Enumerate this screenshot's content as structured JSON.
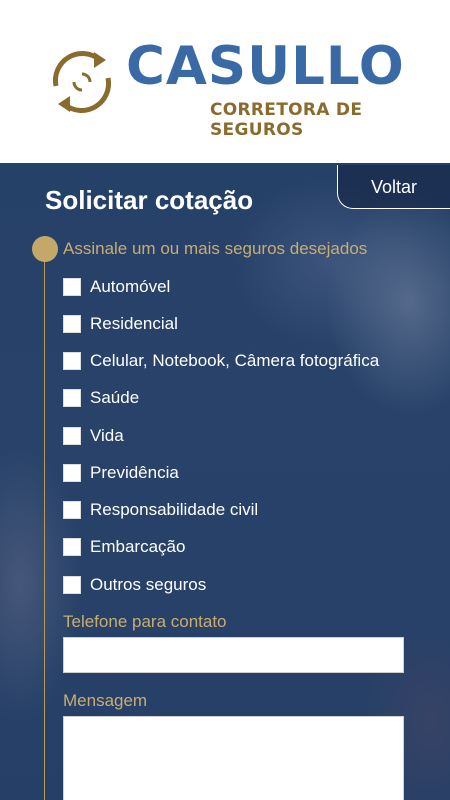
{
  "brand": {
    "name": "CASULLO",
    "subtitle": "CORRETORA DE SEGUROS",
    "logo_icon": "circular-arrows-icon",
    "colors": {
      "blue": "#3a6aa5",
      "gold": "#8a6b2e"
    }
  },
  "form": {
    "title": "Solicitar cotação",
    "back_label": "Voltar",
    "insurance_prompt": "Assinale um ou mais seguros desejados",
    "options": [
      {
        "label": "Automóvel",
        "checked": false
      },
      {
        "label": "Residencial",
        "checked": false
      },
      {
        "label": "Celular, Notebook, Câmera fotográfica",
        "checked": false
      },
      {
        "label": "Saúde",
        "checked": false
      },
      {
        "label": "Vida",
        "checked": false
      },
      {
        "label": "Previdência",
        "checked": false
      },
      {
        "label": "Responsabilidade civil",
        "checked": false
      },
      {
        "label": "Embarcação",
        "checked": false
      },
      {
        "label": "Outros seguros",
        "checked": false
      }
    ],
    "phone_label": "Telefone para contato",
    "phone_value": "",
    "message_label": "Mensagem",
    "message_value": "",
    "accent_color": "#c9ad70"
  }
}
